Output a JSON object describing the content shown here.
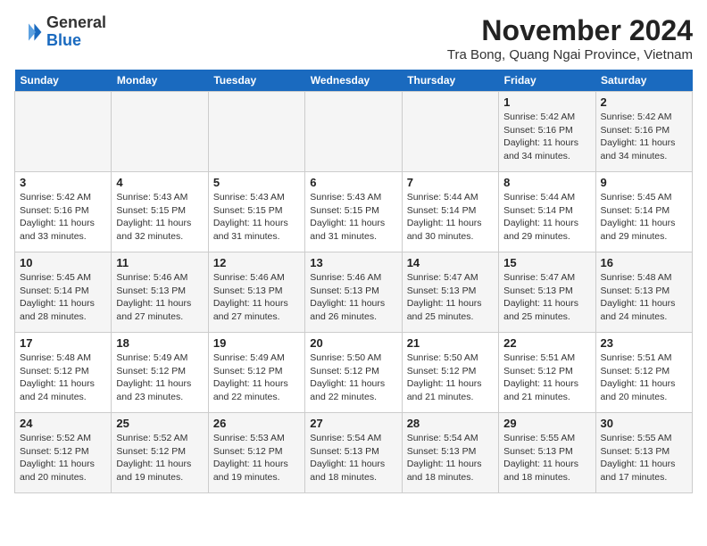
{
  "header": {
    "logo_line1": "General",
    "logo_line2": "Blue",
    "month_title": "November 2024",
    "subtitle": "Tra Bong, Quang Ngai Province, Vietnam"
  },
  "weekdays": [
    "Sunday",
    "Monday",
    "Tuesday",
    "Wednesday",
    "Thursday",
    "Friday",
    "Saturday"
  ],
  "weeks": [
    [
      {
        "day": "",
        "info": ""
      },
      {
        "day": "",
        "info": ""
      },
      {
        "day": "",
        "info": ""
      },
      {
        "day": "",
        "info": ""
      },
      {
        "day": "",
        "info": ""
      },
      {
        "day": "1",
        "info": "Sunrise: 5:42 AM\nSunset: 5:16 PM\nDaylight: 11 hours and 34 minutes."
      },
      {
        "day": "2",
        "info": "Sunrise: 5:42 AM\nSunset: 5:16 PM\nDaylight: 11 hours and 34 minutes."
      }
    ],
    [
      {
        "day": "3",
        "info": "Sunrise: 5:42 AM\nSunset: 5:16 PM\nDaylight: 11 hours and 33 minutes."
      },
      {
        "day": "4",
        "info": "Sunrise: 5:43 AM\nSunset: 5:15 PM\nDaylight: 11 hours and 32 minutes."
      },
      {
        "day": "5",
        "info": "Sunrise: 5:43 AM\nSunset: 5:15 PM\nDaylight: 11 hours and 31 minutes."
      },
      {
        "day": "6",
        "info": "Sunrise: 5:43 AM\nSunset: 5:15 PM\nDaylight: 11 hours and 31 minutes."
      },
      {
        "day": "7",
        "info": "Sunrise: 5:44 AM\nSunset: 5:14 PM\nDaylight: 11 hours and 30 minutes."
      },
      {
        "day": "8",
        "info": "Sunrise: 5:44 AM\nSunset: 5:14 PM\nDaylight: 11 hours and 29 minutes."
      },
      {
        "day": "9",
        "info": "Sunrise: 5:45 AM\nSunset: 5:14 PM\nDaylight: 11 hours and 29 minutes."
      }
    ],
    [
      {
        "day": "10",
        "info": "Sunrise: 5:45 AM\nSunset: 5:14 PM\nDaylight: 11 hours and 28 minutes."
      },
      {
        "day": "11",
        "info": "Sunrise: 5:46 AM\nSunset: 5:13 PM\nDaylight: 11 hours and 27 minutes."
      },
      {
        "day": "12",
        "info": "Sunrise: 5:46 AM\nSunset: 5:13 PM\nDaylight: 11 hours and 27 minutes."
      },
      {
        "day": "13",
        "info": "Sunrise: 5:46 AM\nSunset: 5:13 PM\nDaylight: 11 hours and 26 minutes."
      },
      {
        "day": "14",
        "info": "Sunrise: 5:47 AM\nSunset: 5:13 PM\nDaylight: 11 hours and 25 minutes."
      },
      {
        "day": "15",
        "info": "Sunrise: 5:47 AM\nSunset: 5:13 PM\nDaylight: 11 hours and 25 minutes."
      },
      {
        "day": "16",
        "info": "Sunrise: 5:48 AM\nSunset: 5:13 PM\nDaylight: 11 hours and 24 minutes."
      }
    ],
    [
      {
        "day": "17",
        "info": "Sunrise: 5:48 AM\nSunset: 5:12 PM\nDaylight: 11 hours and 24 minutes."
      },
      {
        "day": "18",
        "info": "Sunrise: 5:49 AM\nSunset: 5:12 PM\nDaylight: 11 hours and 23 minutes."
      },
      {
        "day": "19",
        "info": "Sunrise: 5:49 AM\nSunset: 5:12 PM\nDaylight: 11 hours and 22 minutes."
      },
      {
        "day": "20",
        "info": "Sunrise: 5:50 AM\nSunset: 5:12 PM\nDaylight: 11 hours and 22 minutes."
      },
      {
        "day": "21",
        "info": "Sunrise: 5:50 AM\nSunset: 5:12 PM\nDaylight: 11 hours and 21 minutes."
      },
      {
        "day": "22",
        "info": "Sunrise: 5:51 AM\nSunset: 5:12 PM\nDaylight: 11 hours and 21 minutes."
      },
      {
        "day": "23",
        "info": "Sunrise: 5:51 AM\nSunset: 5:12 PM\nDaylight: 11 hours and 20 minutes."
      }
    ],
    [
      {
        "day": "24",
        "info": "Sunrise: 5:52 AM\nSunset: 5:12 PM\nDaylight: 11 hours and 20 minutes."
      },
      {
        "day": "25",
        "info": "Sunrise: 5:52 AM\nSunset: 5:12 PM\nDaylight: 11 hours and 19 minutes."
      },
      {
        "day": "26",
        "info": "Sunrise: 5:53 AM\nSunset: 5:12 PM\nDaylight: 11 hours and 19 minutes."
      },
      {
        "day": "27",
        "info": "Sunrise: 5:54 AM\nSunset: 5:13 PM\nDaylight: 11 hours and 18 minutes."
      },
      {
        "day": "28",
        "info": "Sunrise: 5:54 AM\nSunset: 5:13 PM\nDaylight: 11 hours and 18 minutes."
      },
      {
        "day": "29",
        "info": "Sunrise: 5:55 AM\nSunset: 5:13 PM\nDaylight: 11 hours and 18 minutes."
      },
      {
        "day": "30",
        "info": "Sunrise: 5:55 AM\nSunset: 5:13 PM\nDaylight: 11 hours and 17 minutes."
      }
    ]
  ]
}
